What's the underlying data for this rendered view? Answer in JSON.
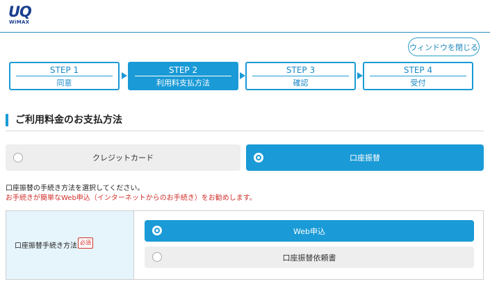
{
  "header": {
    "logo_main": "UQ",
    "logo_sub": "WiMAX"
  },
  "close_button": "ウィンドウを閉じる",
  "steps": [
    {
      "num": "STEP 1",
      "label": "同意",
      "active": false
    },
    {
      "num": "STEP 2",
      "label": "利用料支払方法",
      "active": true
    },
    {
      "num": "STEP 3",
      "label": "確認",
      "active": false
    },
    {
      "num": "STEP 4",
      "label": "受付",
      "active": false
    }
  ],
  "section_title": "ご利用料金のお支払方法",
  "payment_options": [
    {
      "label": "クレジットカード",
      "selected": false
    },
    {
      "label": "口座振替",
      "selected": true
    }
  ],
  "notes": {
    "instruction": "口座振替の手続き方法を選択してください。",
    "recommend": "お手続きが簡単なWeb申込（インターネットからのお手続き）をお勧めします。"
  },
  "form": {
    "label": "口座振替手続き方法",
    "required": "必須",
    "options": [
      {
        "label": "Web申込",
        "selected": true
      },
      {
        "label": "口座振替依頼書",
        "selected": false
      }
    ]
  },
  "colors": {
    "accent": "#1a9ad6",
    "brand": "#1a3f8f",
    "warning": "#d0312d"
  }
}
